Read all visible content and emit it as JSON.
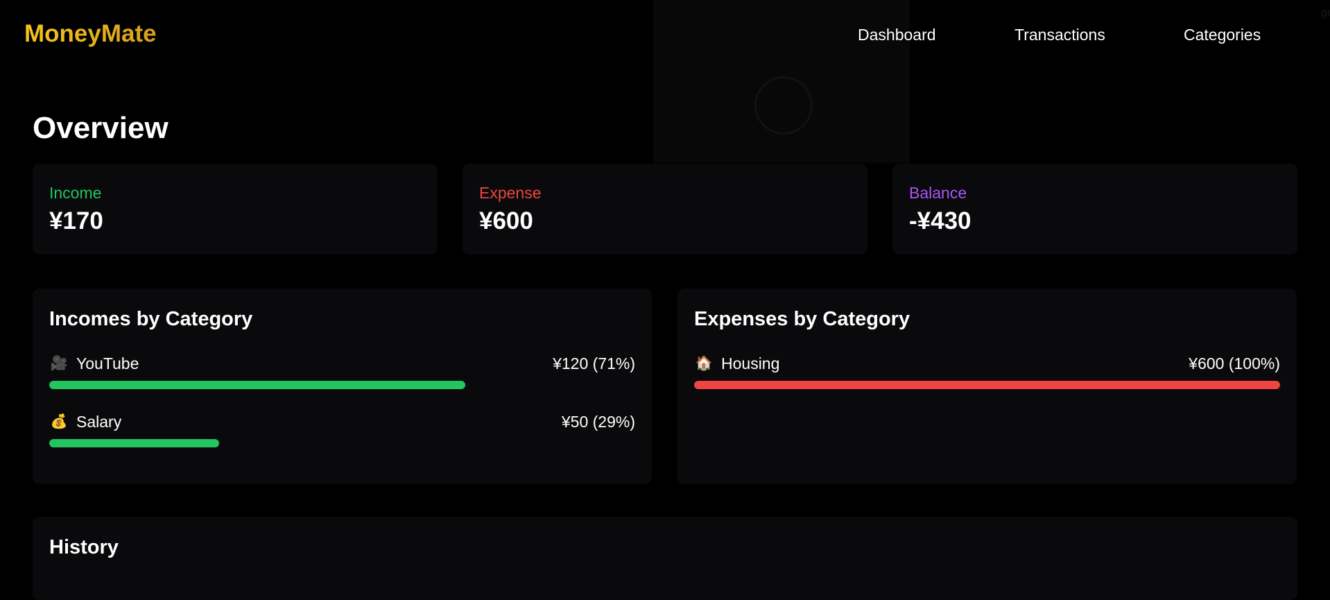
{
  "header": {
    "brand": "MoneyMate",
    "nav": [
      "Dashboard",
      "Transactions",
      "Categories"
    ]
  },
  "overlay": {
    "url_text": "google.com"
  },
  "overview": {
    "title": "Overview",
    "stats": [
      {
        "label": "Income",
        "value": "¥170",
        "color": "#22c55e"
      },
      {
        "label": "Expense",
        "value": "¥600",
        "color": "#ef4444"
      },
      {
        "label": "Balance",
        "value": "-¥430",
        "color": "#a855f7"
      }
    ]
  },
  "incomes_by_category": {
    "title": "Incomes by Category",
    "bar_color": "#22c55e",
    "items": [
      {
        "icon": "video-camera-icon",
        "glyph": "🎥",
        "name": "YouTube",
        "amount": "¥120 (71%)",
        "percent": 71
      },
      {
        "icon": "money-bag-icon",
        "glyph": "💰",
        "name": "Salary",
        "amount": "¥50 (29%)",
        "percent": 29
      }
    ]
  },
  "expenses_by_category": {
    "title": "Expenses by Category",
    "bar_color": "#ef4444",
    "items": [
      {
        "icon": "house-icon",
        "glyph": "🏠",
        "name": "Housing",
        "amount": "¥600 (100%)",
        "percent": 100
      }
    ]
  },
  "history": {
    "title": "History"
  }
}
